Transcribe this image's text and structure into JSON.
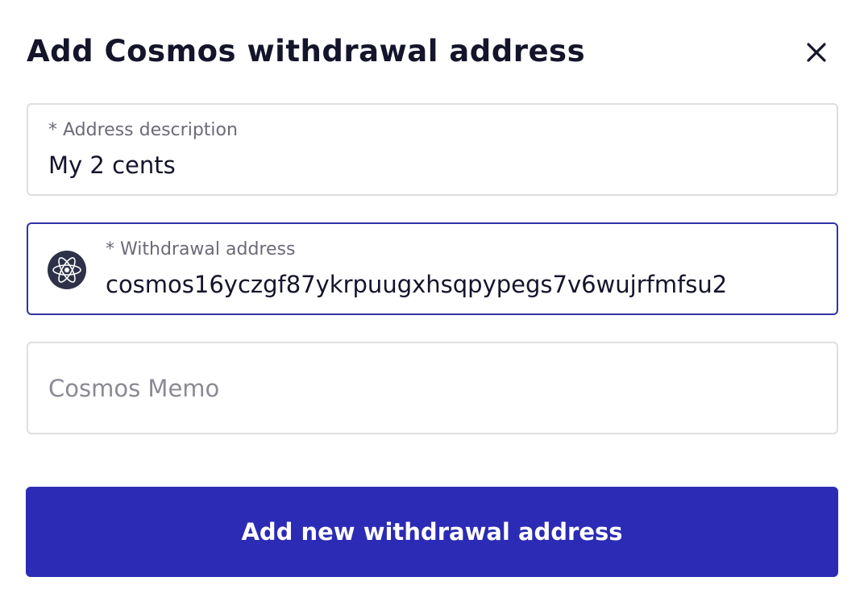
{
  "dialog": {
    "title": "Add Cosmos withdrawal address",
    "close_icon": "close-icon"
  },
  "fields": {
    "description": {
      "label": "* Address description",
      "value": "My 2 cents"
    },
    "address": {
      "label": "* Withdrawal address",
      "value": "cosmos16yczgf87ykrpuugxhsqpypegs7v6wujrfmfsu2",
      "icon": "cosmos-atom-icon",
      "focused": true
    },
    "memo": {
      "placeholder": "Cosmos Memo",
      "value": ""
    }
  },
  "submit": {
    "label": "Add new withdrawal address"
  },
  "colors": {
    "title": "#14142b",
    "focus_border": "#3232a8",
    "button_bg": "#2b2bb5",
    "button_text": "#ffffff"
  }
}
